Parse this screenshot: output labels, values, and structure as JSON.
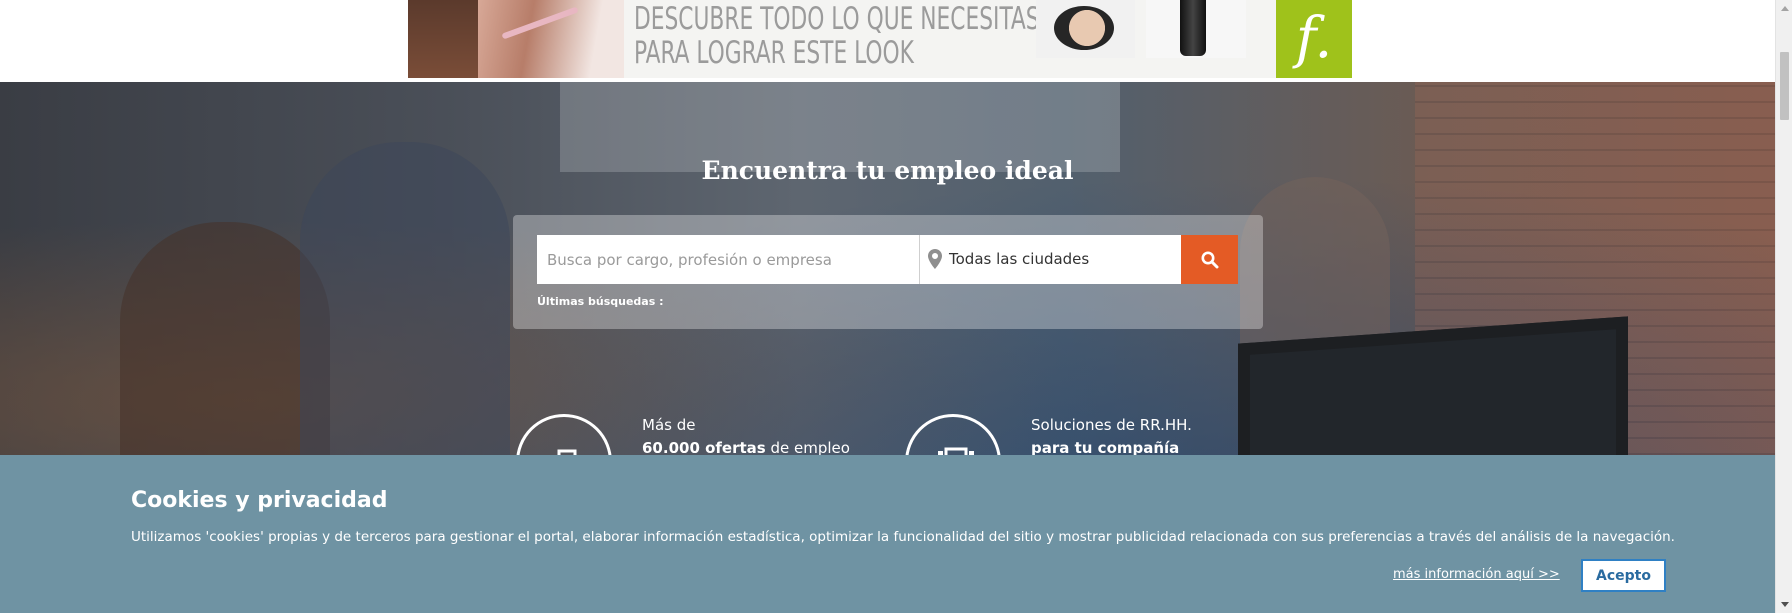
{
  "ad": {
    "headline_line1": "DESCUBRE TODO LO QUE NECESITAS",
    "headline_line2": "PARA LOGRAR ESTE LOOK",
    "brand_logo": "f.",
    "brand_color": "#9fc21b"
  },
  "hero": {
    "title": "Encuentra tu empleo ideal"
  },
  "search": {
    "placeholder": "Busca por cargo, profesión o empresa",
    "city_value": "Todas las ciudades",
    "button_icon": "search-icon",
    "button_color": "#e45b25",
    "recent_label": "Últimas búsquedas :"
  },
  "features": [
    {
      "icon": "briefcase-icon",
      "line1": "Más de",
      "line2_bold": "60.000 ofertas",
      "line2_rest": " de empleo"
    },
    {
      "icon": "hr-solutions-icon",
      "line1": "Soluciones de RR.HH.",
      "line2_bold": "para tu compañía",
      "line2_rest": ""
    }
  ],
  "cookie": {
    "title": "Cookies y privacidad",
    "text": "Utilizamos 'cookies' propias y de terceros para gestionar el portal, elaborar información estadística, optimizar la funcionalidad del sitio y mostrar publicidad relacionada con sus preferencias a través del análisis de la navegación.",
    "more_link": "más información aquí >>",
    "accept": "Acepto",
    "background": "#6f93a3"
  }
}
